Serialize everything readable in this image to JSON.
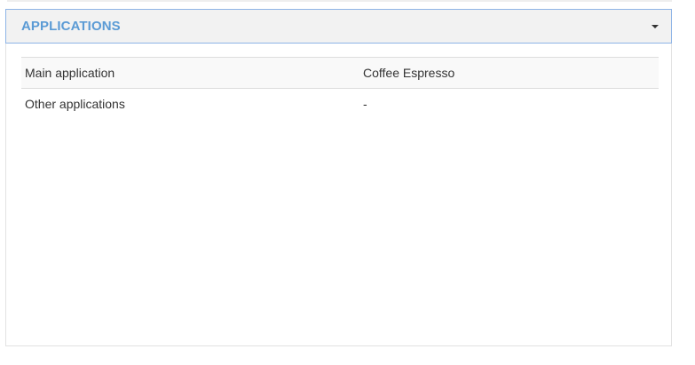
{
  "panel": {
    "title": "APPLICATIONS",
    "toggle_icon": "caret-down-icon"
  },
  "rows": [
    {
      "label": "Main application",
      "value": "Coffee Espresso"
    },
    {
      "label": "Other applications",
      "value": "-"
    }
  ],
  "colors": {
    "title_accent": "#5b9bd5",
    "header_border": "#8eb4e6",
    "header_background": "#f2f2f2"
  }
}
